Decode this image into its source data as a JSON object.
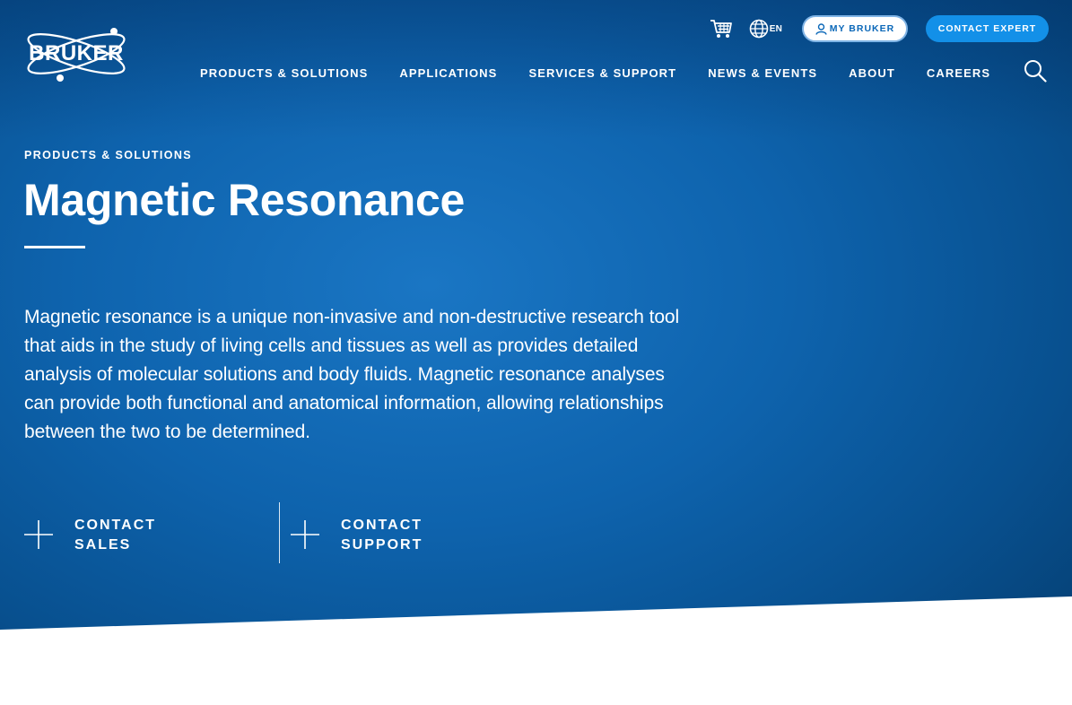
{
  "brand": {
    "name": "BRUKER"
  },
  "utility": {
    "cart_icon": "cart-icon",
    "language_icon": "globe-icon",
    "language": "EN",
    "my_bruker_label": "MY BRUKER",
    "contact_expert_label": "CONTACT EXPERT"
  },
  "nav": {
    "items": [
      {
        "label": "PRODUCTS & SOLUTIONS"
      },
      {
        "label": "APPLICATIONS"
      },
      {
        "label": "SERVICES & SUPPORT"
      },
      {
        "label": "NEWS & EVENTS"
      },
      {
        "label": "ABOUT"
      },
      {
        "label": "CAREERS"
      }
    ],
    "search_icon": "search-icon"
  },
  "hero": {
    "eyebrow": "PRODUCTS & SOLUTIONS",
    "title": "Magnetic Resonance",
    "description": "Magnetic resonance is a unique non-invasive and non-destructive research tool that aids in the study of living cells and tissues as well as provides detailed analysis of molecular solutions and body fluids. Magnetic resonance analyses can provide both functional and anatomical information, allowing relationships between the two to be determined.",
    "cta_sales": "CONTACT SALES",
    "cta_support": "CONTACT SUPPORT"
  },
  "colors": {
    "hero_blue": "#0e63ad",
    "accent_blue": "#1390e8",
    "text": "#ffffff"
  }
}
